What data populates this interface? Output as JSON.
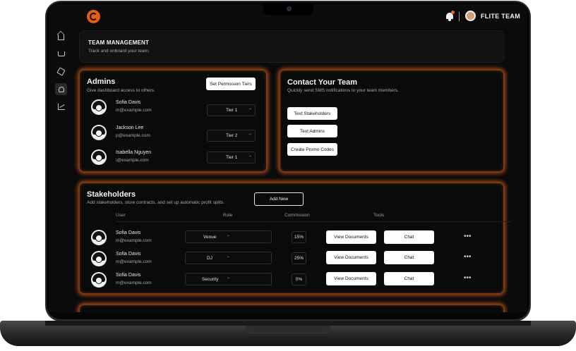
{
  "brand": {
    "name": "FLITE TEAM"
  },
  "icons": {
    "logo": "brand-logo-icon",
    "notifications": "bell-icon",
    "nav": [
      "home-icon",
      "cart-icon",
      "cube-icon",
      "users-icon",
      "chart-icon"
    ]
  },
  "colors": {
    "accent": "#e2601e",
    "background": "#0b0b0b",
    "button": "#ffffff"
  },
  "header": {
    "title": "TEAM MANAGEMENT",
    "subtitle": "Track and onboard your team."
  },
  "admins": {
    "title": "Admins",
    "subtitle": "Give dashboard access to others.",
    "action_label": "Set Permission Tiers",
    "items": [
      {
        "name": "Sofia Davis",
        "email": "m@example.com",
        "tier": "Tier 1"
      },
      {
        "name": "Jackson Lee",
        "email": "p@example.com",
        "tier": "Tier 2"
      },
      {
        "name": "Isabella Nguyen",
        "email": "i@example.com",
        "tier": "Tier 1"
      }
    ]
  },
  "contact": {
    "title": "Contact Your Team",
    "subtitle": "Quickly send SMS notifications to your team members.",
    "buttons": [
      "Text Stakeholders",
      "Text Admins",
      "Create Promo Codes"
    ]
  },
  "stakeholders": {
    "title": "Stakeholders",
    "subtitle": "Add stakeholders, store contracts, and set up automatic profit splits.",
    "add_label": "Add New",
    "columns": [
      "User",
      "Role",
      "Commission",
      "Tools"
    ],
    "view_label": "View Documents",
    "chat_label": "Chat",
    "more_label": "•••",
    "rows": [
      {
        "name": "Sofia Davis",
        "email": "m@example.com",
        "role": "Venue",
        "commission": "15%"
      },
      {
        "name": "Sofia Davis",
        "email": "m@example.com",
        "role": "DJ",
        "commission": "25%"
      },
      {
        "name": "Sofia Davis",
        "email": "m@example.com",
        "role": "Security",
        "commission": "0%"
      }
    ]
  }
}
